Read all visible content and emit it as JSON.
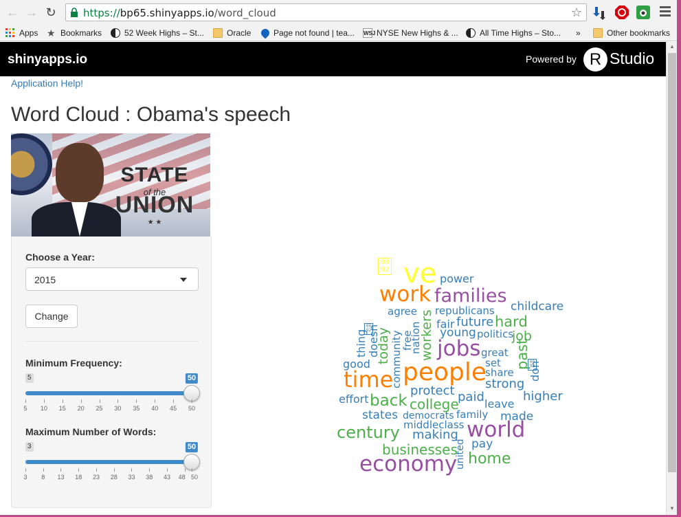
{
  "browser": {
    "url_secure": "https://",
    "url_host": "bp65.shinyapps.io",
    "url_path": "/word_cloud",
    "bookmarks": [
      {
        "label": "Apps",
        "icon": "apps-grid-icon"
      },
      {
        "label": "Bookmarks",
        "icon": "star-icon"
      },
      {
        "label": "52 Week Highs – St...",
        "icon": "halfmoon-icon"
      },
      {
        "label": "Oracle",
        "icon": "folder-icon"
      },
      {
        "label": "Page not found | tea...",
        "icon": "drop-icon"
      },
      {
        "label": "NYSE New Highs & ...",
        "icon": "wsj-icon"
      },
      {
        "label": "All Time Highs – Sto...",
        "icon": "halfmoon-icon"
      },
      {
        "label": "»",
        "icon": ""
      },
      {
        "label": "Other bookmarks",
        "icon": "folder-icon"
      }
    ],
    "wsj_text": "WSJ"
  },
  "navbar": {
    "brand": "shinyapps.io",
    "powered_by": "Powered by",
    "r_logo": "R",
    "studio": "Studio"
  },
  "page": {
    "help_link": "Application Help!",
    "title": "Word Cloud : Obama's speech",
    "hero": {
      "state": "STATE",
      "of_the": "of the",
      "union": "UNION",
      "stars": "★ ★"
    }
  },
  "controls": {
    "year_label": "Choose a Year:",
    "year_value": "2015",
    "change_button": "Change",
    "min_freq": {
      "label": "Minimum Frequency:",
      "min_badge": "5",
      "max_badge": "50",
      "value": 50,
      "min": 5,
      "max": 50,
      "tick_labels": [
        "5",
        "10",
        "15",
        "20",
        "25",
        "30",
        "35",
        "40",
        "45",
        "50"
      ]
    },
    "max_words": {
      "label": "Maximum Number of Words:",
      "min_badge": "3",
      "max_badge": "50",
      "value": 50,
      "min": 3,
      "max": 50,
      "tick_labels": [
        "3",
        "8",
        "13",
        "18",
        "23",
        "28",
        "33",
        "38",
        "43",
        "48",
        "50"
      ]
    }
  },
  "wordcloud": {
    "colors": {
      "yellow": "#ffff33",
      "orange": "#ff7f00",
      "purple": "#984ea3",
      "green": "#4daf4a",
      "blue": "#377eb8"
    },
    "words": [
      {
        "text": "\u00020092",
        "color": "yellow"
      },
      {
        "text": "ve",
        "color": "yellow"
      },
      {
        "text": "power",
        "color": "blue"
      },
      {
        "text": "work",
        "color": "orange"
      },
      {
        "text": "families",
        "color": "purple"
      },
      {
        "text": "childcare",
        "color": "blue"
      },
      {
        "text": "agree",
        "color": "blue"
      },
      {
        "text": "republicans",
        "color": "blue"
      },
      {
        "text": "future",
        "color": "blue"
      },
      {
        "text": "hard",
        "color": "green"
      },
      {
        "text": "fair",
        "color": "blue"
      },
      {
        "text": "young",
        "color": "blue"
      },
      {
        "text": "politics",
        "color": "blue"
      },
      {
        "text": "job",
        "color": "green"
      },
      {
        "text": "jobs",
        "color": "purple"
      },
      {
        "text": "great",
        "color": "blue"
      },
      {
        "text": "set",
        "color": "blue"
      },
      {
        "text": "share",
        "color": "blue"
      },
      {
        "text": "strong",
        "color": "blue"
      },
      {
        "text": "good",
        "color": "blue"
      },
      {
        "text": "time",
        "color": "orange"
      },
      {
        "text": "people",
        "color": "orange"
      },
      {
        "text": "protect",
        "color": "blue"
      },
      {
        "text": "effort",
        "color": "blue"
      },
      {
        "text": "back",
        "color": "green"
      },
      {
        "text": "college",
        "color": "green"
      },
      {
        "text": "paid",
        "color": "blue"
      },
      {
        "text": "leave",
        "color": "blue"
      },
      {
        "text": "higher",
        "color": "blue"
      },
      {
        "text": "states",
        "color": "blue"
      },
      {
        "text": "democrats",
        "color": "blue"
      },
      {
        "text": "family",
        "color": "blue"
      },
      {
        "text": "made",
        "color": "blue"
      },
      {
        "text": "middleclass",
        "color": "blue"
      },
      {
        "text": "century",
        "color": "green"
      },
      {
        "text": "making",
        "color": "blue"
      },
      {
        "text": "world",
        "color": "purple"
      },
      {
        "text": "pay",
        "color": "blue"
      },
      {
        "text": "businesses",
        "color": "green"
      },
      {
        "text": "home",
        "color": "green"
      },
      {
        "text": "economy",
        "color": "purple"
      },
      {
        "text": "thing",
        "color": "blue"
      },
      {
        "text": "doesn",
        "color": "blue"
      },
      {
        "text": "today",
        "color": "green"
      },
      {
        "text": "community",
        "color": "blue"
      },
      {
        "text": "free",
        "color": "blue"
      },
      {
        "text": "nation",
        "color": "blue"
      },
      {
        "text": "workers",
        "color": "green"
      },
      {
        "text": "past",
        "color": "green"
      },
      {
        "text": "don",
        "color": "blue"
      },
      {
        "text": "united",
        "color": "blue"
      },
      {
        "text": "\u00020092",
        "color": "blue"
      },
      {
        "text": "\u00020092",
        "color": "blue"
      }
    ]
  }
}
